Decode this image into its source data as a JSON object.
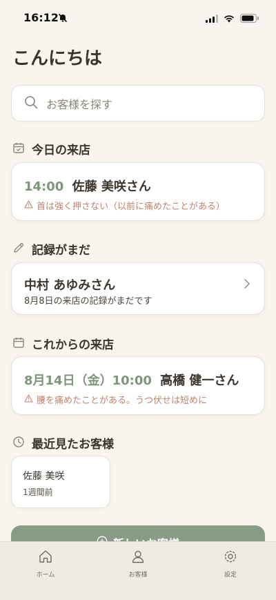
{
  "status": {
    "time": "16:12"
  },
  "header": {
    "greeting": "こんにちは"
  },
  "search": {
    "placeholder": "お客様を探す"
  },
  "today": {
    "title": "今日の来店",
    "visit": {
      "time": "14:00",
      "name": "佐藤 美咲さん",
      "note": "首は強く押さない（以前に痛めたことがある）"
    }
  },
  "pending": {
    "title": "記録がまだ",
    "item": {
      "name": "中村 あゆみさん",
      "detail": "8月8日の来店の記録がまだです"
    }
  },
  "upcoming": {
    "title": "これからの来店",
    "visit": {
      "date": "8月14日（金）10:00",
      "name": "高橋 健一さん",
      "note": "腰を痛めたことがある。うつ伏せは短めに"
    }
  },
  "recent": {
    "title": "最近見たお客様",
    "items": [
      {
        "name": "佐藤 美咲",
        "when": "1週間前"
      }
    ]
  },
  "actions": {
    "new_customer": "新しいお客様"
  },
  "tabs": [
    {
      "label": "ホーム"
    },
    {
      "label": "お客様"
    },
    {
      "label": "設定"
    }
  ],
  "colors": {
    "accent": "#7e947b",
    "warning": "#c2836c",
    "background": "#f8f5ef",
    "button": "#899d86"
  }
}
